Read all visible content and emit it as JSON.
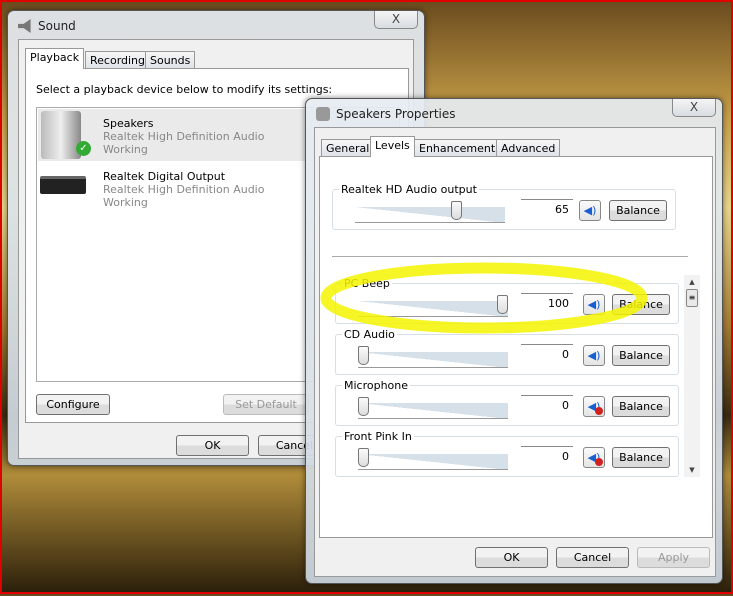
{
  "sound": {
    "title": "Sound",
    "tabs": [
      "Playback",
      "Recording",
      "Sounds"
    ],
    "instruction": "Select a playback device below to modify its settings:",
    "devices": [
      {
        "name": "Speakers",
        "driver": "Realtek High Definition Audio",
        "status": "Working",
        "default": true
      },
      {
        "name": "Realtek Digital Output",
        "driver": "Realtek High Definition Audio",
        "status": "Working",
        "default": false
      }
    ],
    "configure": "Configure",
    "set_default": "Set Default",
    "ok": "OK",
    "cancel": "Cancel",
    "close": "X"
  },
  "props": {
    "title": "Speakers Properties",
    "tabs": [
      "General",
      "Levels",
      "Enhancements",
      "Advanced"
    ],
    "master": {
      "label": "Realtek HD Audio output",
      "value": "65",
      "muted": false
    },
    "channels": [
      {
        "label": "PC Beep",
        "value": "100",
        "muted": false
      },
      {
        "label": "CD Audio",
        "value": "0",
        "muted": false
      },
      {
        "label": "Microphone",
        "value": "0",
        "muted": true
      },
      {
        "label": "Front Pink In",
        "value": "0",
        "muted": true
      }
    ],
    "balance": "Balance",
    "ok": "OK",
    "cancel": "Cancel",
    "apply": "Apply",
    "close": "X"
  },
  "highlight_color": "#f5f500"
}
